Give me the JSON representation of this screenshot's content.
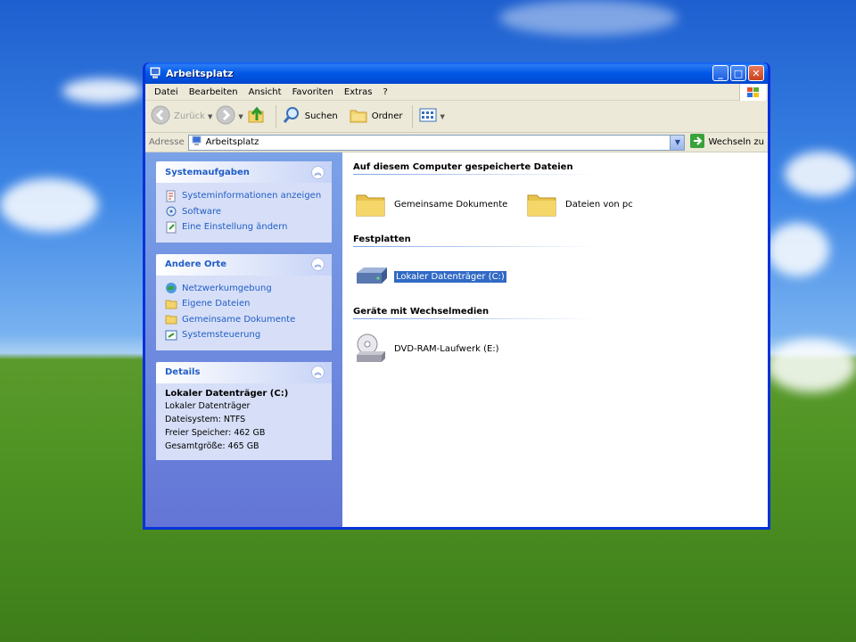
{
  "window": {
    "title": "Arbeitsplatz",
    "controls": {
      "minimize": "_",
      "maximize": "□",
      "close": "✕"
    }
  },
  "menu": [
    "Datei",
    "Bearbeiten",
    "Ansicht",
    "Favoriten",
    "Extras",
    "?"
  ],
  "toolbar": {
    "back": "Zurück",
    "search": "Suchen",
    "folders": "Ordner"
  },
  "address": {
    "label": "Adresse",
    "value": "Arbeitsplatz",
    "go": "Wechseln zu"
  },
  "taskpane": {
    "system_tasks": {
      "title": "Systemaufgaben",
      "items": [
        "Systeminformationen anzeigen",
        "Software",
        "Eine Einstellung ändern"
      ]
    },
    "other_places": {
      "title": "Andere Orte",
      "items": [
        "Netzwerkumgebung",
        "Eigene Dateien",
        "Gemeinsame Dokumente",
        "Systemsteuerung"
      ]
    },
    "details": {
      "title": "Details",
      "name": "Lokaler Datenträger (C:)",
      "type": "Lokaler Datenträger",
      "filesystem": "Dateisystem: NTFS",
      "free": "Freier Speicher: 462 GB",
      "total": "Gesamtgröße: 465 GB"
    }
  },
  "main": {
    "groups": [
      {
        "title": "Auf diesem Computer gespeicherte Dateien",
        "items": [
          "Gemeinsame Dokumente",
          "Dateien von pc"
        ]
      },
      {
        "title": "Festplatten",
        "items": [
          "Lokaler Datenträger (C:)"
        ]
      },
      {
        "title": "Geräte mit Wechselmedien",
        "items": [
          "DVD-RAM-Laufwerk (E:)"
        ]
      }
    ]
  },
  "colors": {
    "titlebar": "#0058e6",
    "taskpane": "#6d8fe0",
    "link": "#215dc6",
    "selection": "#316ac5"
  }
}
